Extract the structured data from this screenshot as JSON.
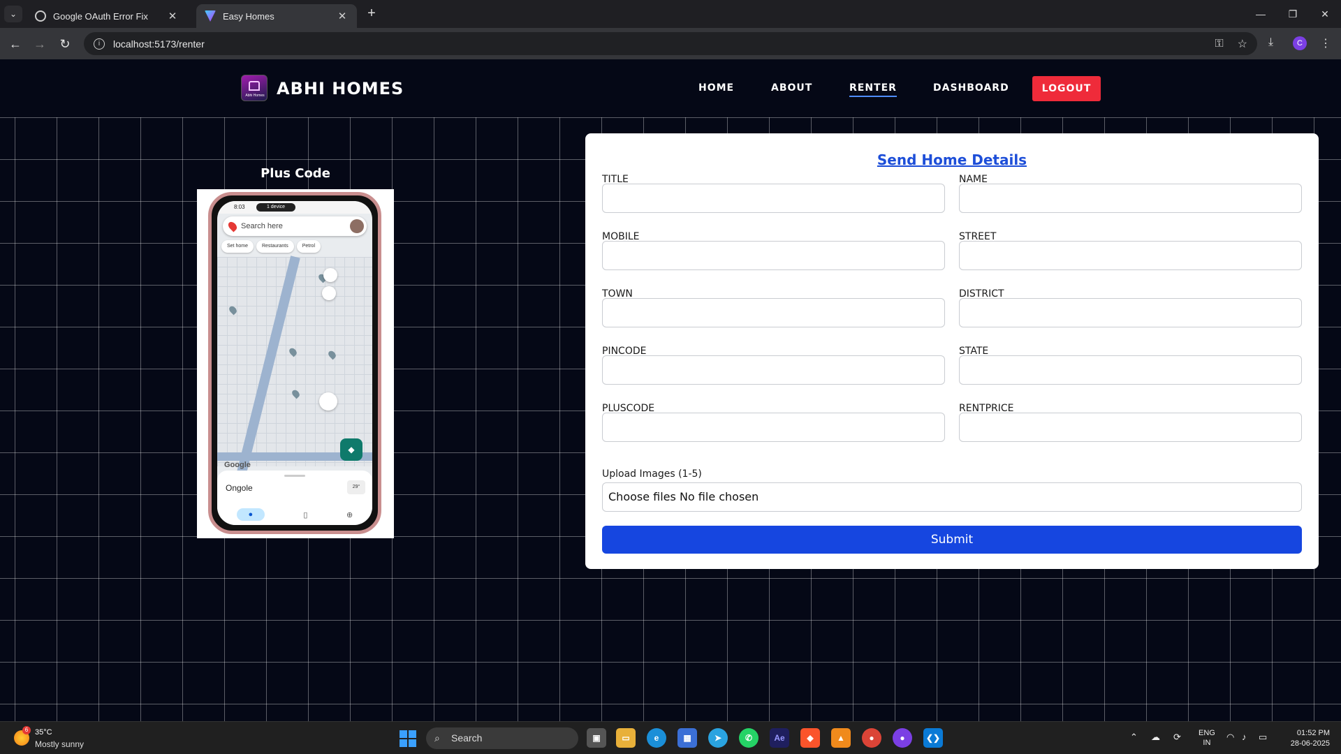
{
  "browser": {
    "tabs": [
      {
        "label": "Google OAuth Error Fix",
        "active": false
      },
      {
        "label": "Easy Homes",
        "active": true
      }
    ],
    "new_tab": "+",
    "url": "localhost:5173/renter",
    "profile_initial": "C",
    "window_controls": {
      "minimize": "—",
      "restore": "❐",
      "close": "✕"
    }
  },
  "header": {
    "logo_text": "Abhi Homes",
    "brand": "ABHI HOMES",
    "nav": [
      {
        "label": "HOME",
        "active": false
      },
      {
        "label": "ABOUT",
        "active": false
      },
      {
        "label": "RENTER",
        "active": true
      },
      {
        "label": "DASHBOARD",
        "active": false
      }
    ],
    "logout_label": "LOGOUT"
  },
  "plus_code": {
    "title": "Plus Code",
    "phone": {
      "time": "8:03",
      "device_pill": "1 device",
      "search_placeholder": "Search here",
      "chips": [
        "Set home",
        "Restaurants",
        "Petrol"
      ],
      "map_brand": "Google",
      "place": "Ongole",
      "temp": "29°"
    }
  },
  "form": {
    "title": "Send Home Details",
    "fields": [
      {
        "label": "TITLE",
        "value": ""
      },
      {
        "label": "NAME",
        "value": ""
      },
      {
        "label": "MOBILE",
        "value": ""
      },
      {
        "label": "STREET",
        "value": ""
      },
      {
        "label": "TOWN",
        "value": ""
      },
      {
        "label": "DISTRICT",
        "value": ""
      },
      {
        "label": "PINCODE",
        "value": ""
      },
      {
        "label": "STATE",
        "value": ""
      },
      {
        "label": "PLUSCODE",
        "value": ""
      },
      {
        "label": "RENTPRICE",
        "value": ""
      }
    ],
    "upload_label": "Upload Images (1-5)",
    "file_input_text": "Choose files No file chosen",
    "submit_label": "Submit"
  },
  "taskbar": {
    "weather_badge": "6",
    "weather_temp": "35°C",
    "weather_desc": "Mostly sunny",
    "search_label": "Search",
    "lang_line1": "ENG",
    "lang_line2": "IN",
    "time": "01:52 PM",
    "date": "28-06-2025"
  },
  "colors": {
    "page_bg": "#050816",
    "accent_blue": "#1646e0",
    "title_blue": "#1d4ed8",
    "logout_red": "#ef2b3a"
  }
}
